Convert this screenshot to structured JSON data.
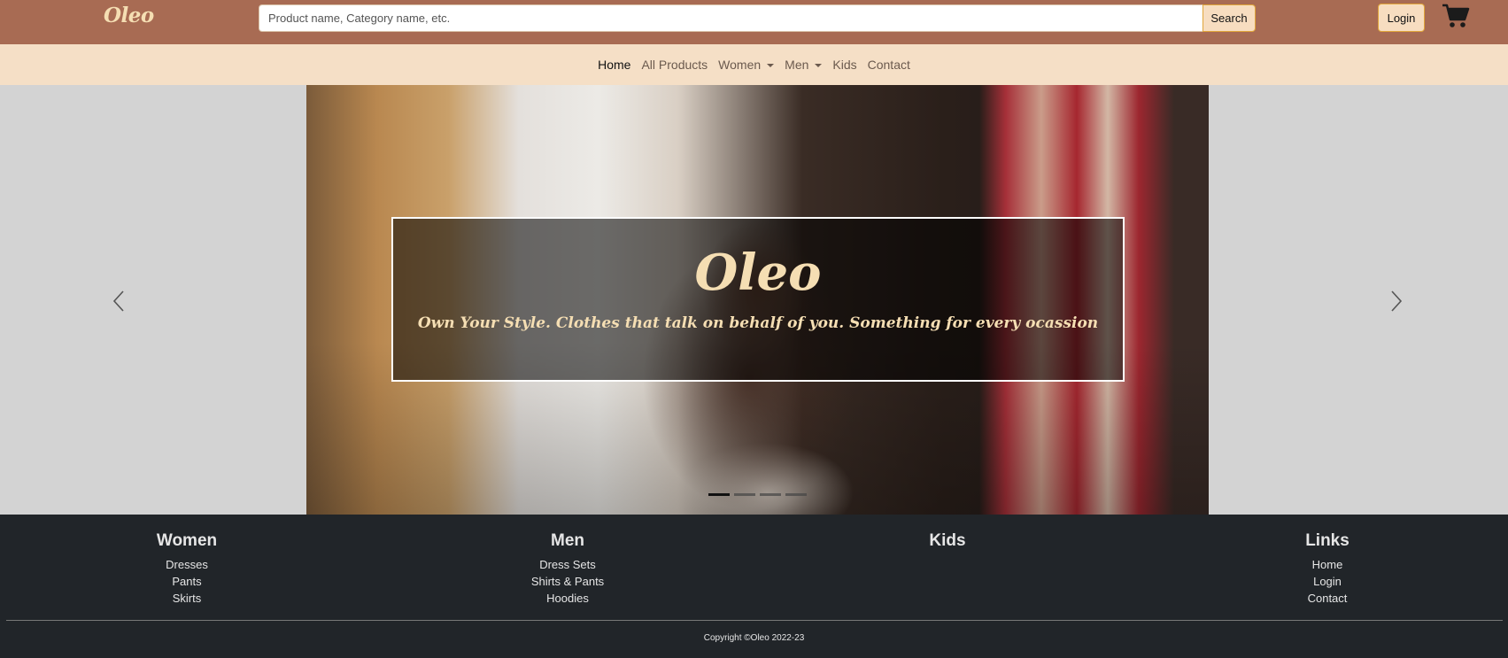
{
  "header": {
    "brand": "Oleo",
    "search_placeholder": "Product name, Category name, etc.",
    "search_label": "Search",
    "login_label": "Login",
    "cart_icon": "cart-icon"
  },
  "nav": {
    "items": [
      {
        "label": "Home",
        "active": true,
        "dropdown": false
      },
      {
        "label": "All Products",
        "active": false,
        "dropdown": false
      },
      {
        "label": "Women",
        "active": false,
        "dropdown": true
      },
      {
        "label": "Men",
        "active": false,
        "dropdown": true
      },
      {
        "label": "Kids",
        "active": false,
        "dropdown": false
      },
      {
        "label": "Contact",
        "active": false,
        "dropdown": false
      }
    ]
  },
  "carousel": {
    "title": "Oleo",
    "subtitle": "Own Your Style. Clothes that talk on behalf of you. Something for every ocassion",
    "slide_count": 4,
    "active_slide": 1,
    "prev_icon": "chevron-left-icon",
    "next_icon": "chevron-right-icon"
  },
  "footer": {
    "women": {
      "heading": "Women",
      "links": [
        "Dresses",
        "Pants",
        "Skirts"
      ]
    },
    "men": {
      "heading": "Men",
      "links": [
        "Dress Sets",
        "Shirts & Pants",
        "Hoodies"
      ]
    },
    "kids": {
      "heading": "Kids",
      "links": []
    },
    "links": {
      "heading": "Links",
      "items": [
        "Home",
        "Login",
        "Contact"
      ]
    },
    "copyright": "Copyright ©Oleo 2022-23"
  },
  "colors": {
    "header_bg": "#a86b53",
    "nav_bg": "#f5dfc6",
    "accent": "#f5deb3",
    "footer_bg": "#212529"
  }
}
